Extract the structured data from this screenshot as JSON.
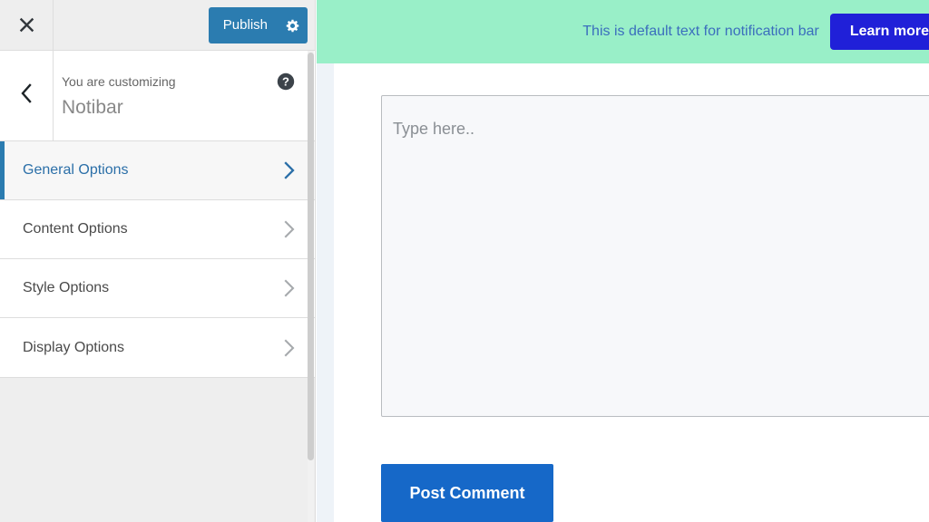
{
  "customizer": {
    "topbar": {
      "close_icon": "close-icon",
      "publish_label": "Publish",
      "settings_icon": "gear-icon"
    },
    "header": {
      "back_icon": "chevron-left-icon",
      "eyebrow": "You are customizing",
      "title": "Notibar",
      "help_icon": "help-circle-icon"
    },
    "panels": [
      {
        "label": "General Options",
        "chevron": "chevron-right-icon",
        "active": true
      },
      {
        "label": "Content Options",
        "chevron": "chevron-right-icon",
        "active": false
      },
      {
        "label": "Style Options",
        "chevron": "chevron-right-icon",
        "active": false
      },
      {
        "label": "Display Options",
        "chevron": "chevron-right-icon",
        "active": false
      }
    ]
  },
  "preview": {
    "notification_bar": {
      "text": "This is default text for notification bar",
      "cta_label": "Learn more",
      "background_color": "#99efc8",
      "text_color": "#3b6ebd",
      "cta_background_color": "#2020d8",
      "cta_text_color": "#ffffff"
    },
    "comment_form": {
      "textarea_placeholder": "Type here..",
      "submit_label": "Post Comment",
      "submit_color": "#1668c8"
    }
  },
  "colors": {
    "accent": "#2b7cb0",
    "sidebar_bg": "#eeeeee",
    "panel_bg": "#ffffff",
    "active_panel_text": "#2b6fa8"
  }
}
